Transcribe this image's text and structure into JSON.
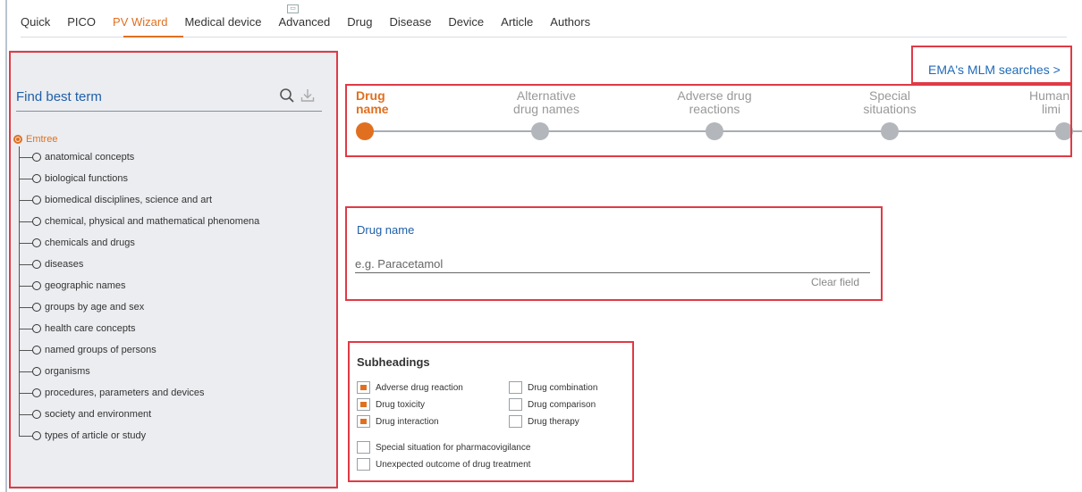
{
  "tabs": [
    {
      "label": "Quick"
    },
    {
      "label": "PICO"
    },
    {
      "label": "PV Wizard",
      "active": true
    },
    {
      "label": "Medical device"
    },
    {
      "label": "Advanced"
    },
    {
      "label": "Drug"
    },
    {
      "label": "Disease"
    },
    {
      "label": "Device"
    },
    {
      "label": "Article"
    },
    {
      "label": "Authors"
    }
  ],
  "find": {
    "title": "Find best term",
    "search_icon": "search-icon",
    "download_icon": "download-icon"
  },
  "tree": {
    "root": "Emtree",
    "items": [
      "anatomical concepts",
      "biological functions",
      "biomedical disciplines, science and art",
      "chemical, physical and mathematical phenomena",
      "chemicals and drugs",
      "diseases",
      "geographic names",
      "groups by age and sex",
      "health care concepts",
      "named groups of persons",
      "organisms",
      "procedures, parameters and devices",
      "society and environment",
      "types of article or study"
    ]
  },
  "ema_link": "EMA's MLM searches >",
  "steps": [
    {
      "line1": "Drug",
      "line2": "name",
      "active": true
    },
    {
      "line1": "Alternative",
      "line2": "drug names"
    },
    {
      "line1": "Adverse drug",
      "line2": "reactions"
    },
    {
      "line1": "Special",
      "line2": "situations"
    },
    {
      "line1": "Human",
      "line2": "limi"
    }
  ],
  "drug_name": {
    "label": "Drug name",
    "placeholder": "e.g. Paracetamol",
    "value": "",
    "clear": "Clear field"
  },
  "subheadings": {
    "title": "Subheadings",
    "items": [
      {
        "label": "Adverse drug reaction",
        "checked": true
      },
      {
        "label": "Drug toxicity",
        "checked": true
      },
      {
        "label": "Drug interaction",
        "checked": true
      },
      {
        "label": "Drug combination",
        "checked": false
      },
      {
        "label": "Drug comparison",
        "checked": false
      },
      {
        "label": "Drug therapy",
        "checked": false
      },
      {
        "label": "Special situation for pharmacovigilance",
        "checked": false
      },
      {
        "label": "Unexpected outcome of drug treatment",
        "checked": false
      }
    ]
  },
  "colors": {
    "accent": "#e07020",
    "link": "#1f6ab8",
    "highlight_box": "#e03a46",
    "panel_bg": "#ebedf0"
  }
}
